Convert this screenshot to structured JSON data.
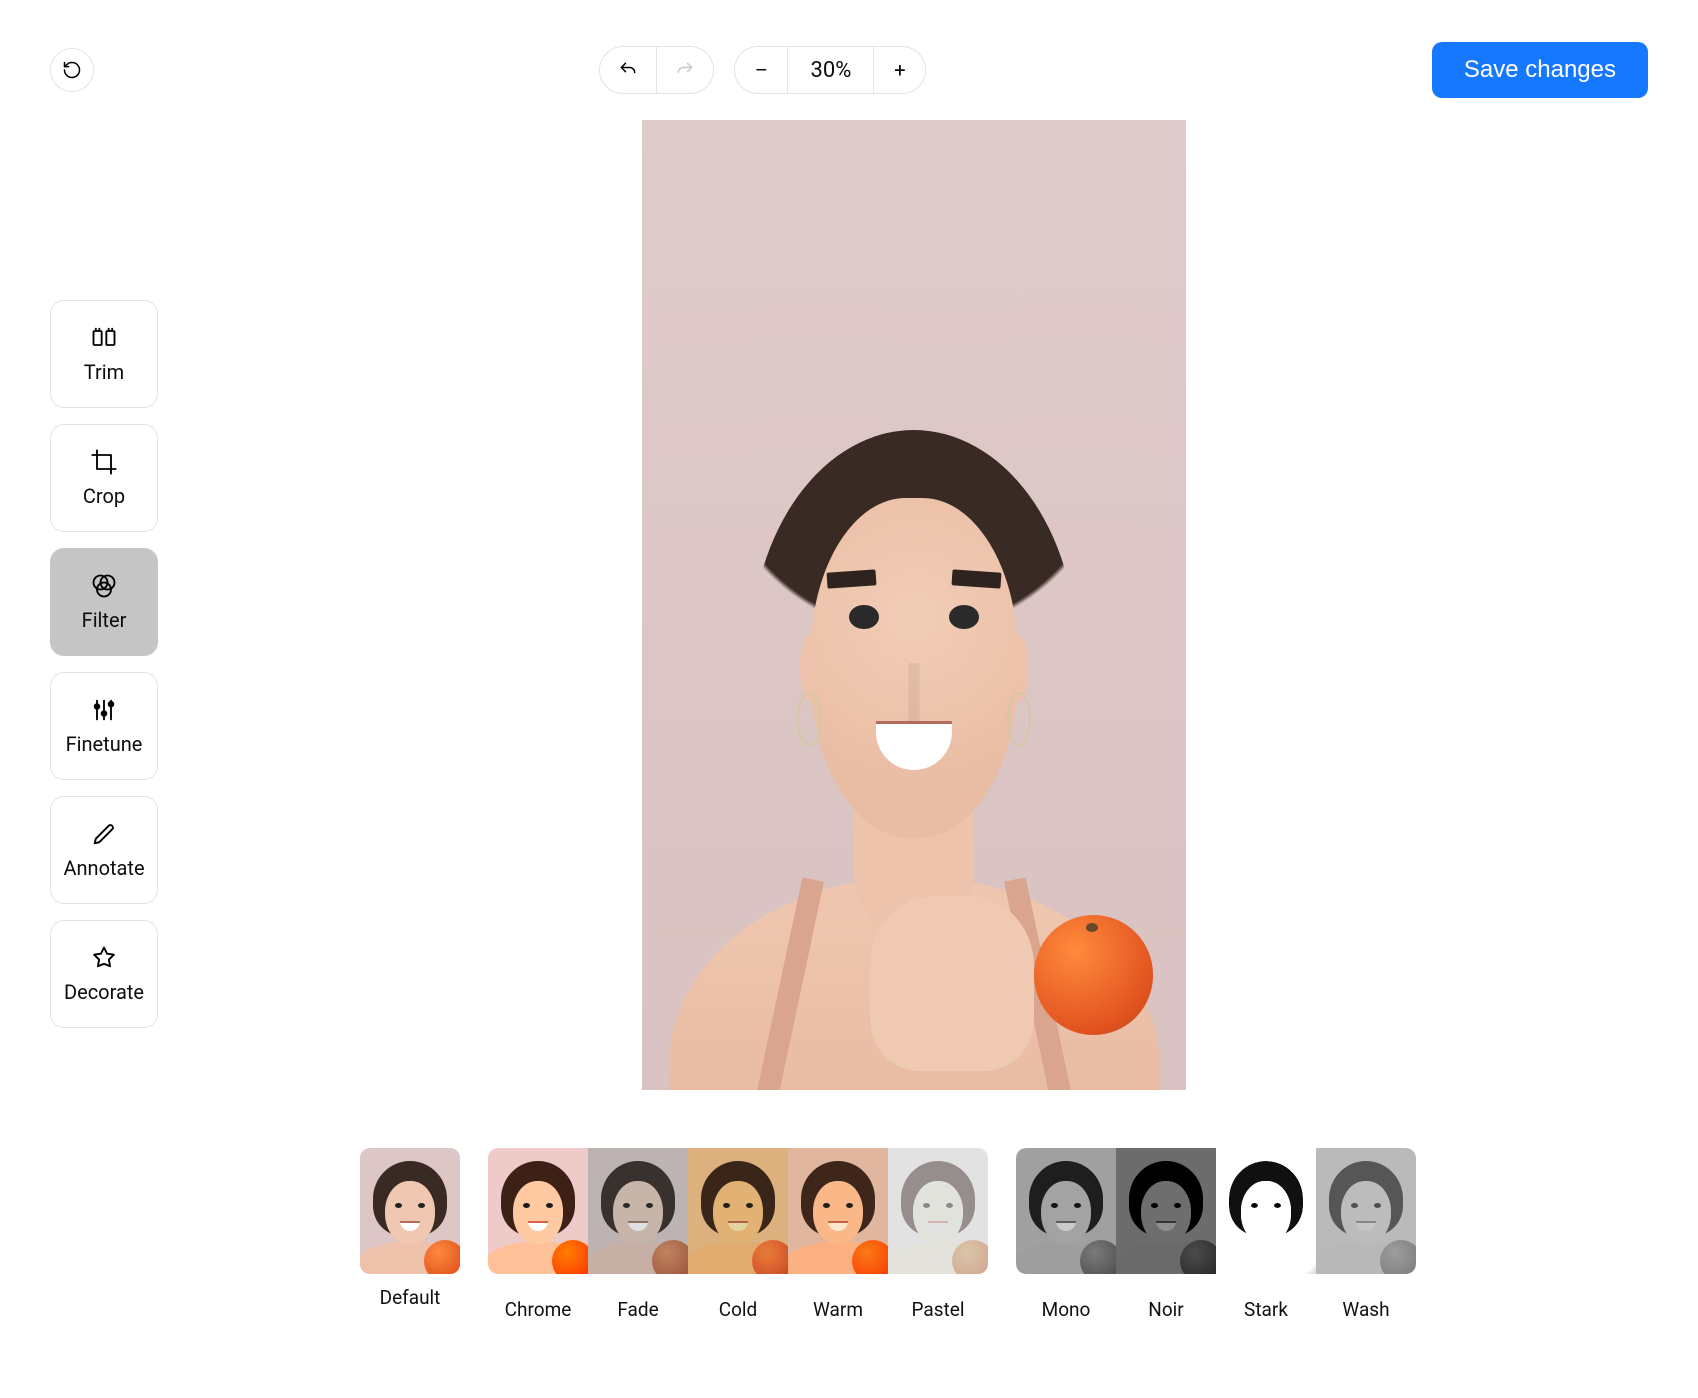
{
  "header": {
    "zoom_label": "30%",
    "zoom_out": "–",
    "zoom_in": "+",
    "save_label": "Save changes"
  },
  "tools": {
    "trim": {
      "label": "Trim",
      "active": false
    },
    "crop": {
      "label": "Crop",
      "active": false
    },
    "filter": {
      "label": "Filter",
      "active": true
    },
    "finetune": {
      "label": "Finetune",
      "active": false
    },
    "annotate": {
      "label": "Annotate",
      "active": false
    },
    "decorate": {
      "label": "Decorate",
      "active": false
    }
  },
  "filters": {
    "default": "Default",
    "color_group": [
      {
        "key": "chrome",
        "label": "Chrome"
      },
      {
        "key": "fade",
        "label": "Fade"
      },
      {
        "key": "cold",
        "label": "Cold"
      },
      {
        "key": "warm",
        "label": "Warm"
      },
      {
        "key": "pastel",
        "label": "Pastel"
      }
    ],
    "bw_group": [
      {
        "key": "mono",
        "label": "Mono"
      },
      {
        "key": "noir",
        "label": "Noir"
      },
      {
        "key": "stark",
        "label": "Stark"
      },
      {
        "key": "wash",
        "label": "Wash"
      }
    ],
    "selected": "default"
  },
  "colors": {
    "accent": "#1678ff"
  }
}
